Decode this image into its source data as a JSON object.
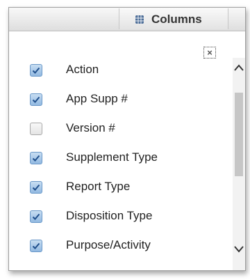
{
  "toolbar": {
    "columns_button": {
      "label": "Columns",
      "icon": "columns-grid-icon"
    }
  },
  "close_button": {
    "label": "×",
    "icon": "close-icon"
  },
  "column_items": [
    {
      "label": "Action",
      "checked": true
    },
    {
      "label": "App Supp #",
      "checked": true
    },
    {
      "label": "Version #",
      "checked": false
    },
    {
      "label": "Supplement Type",
      "checked": true
    },
    {
      "label": "Report Type",
      "checked": true
    },
    {
      "label": "Disposition Type",
      "checked": true
    },
    {
      "label": "Purpose/Activity",
      "checked": true
    }
  ],
  "colors": {
    "checkbox_checked": "#92b9e1",
    "checkmark": "#1f4f8c",
    "panel_border": "#9e9e9e",
    "scroll_thumb": "#c6c6c6"
  }
}
